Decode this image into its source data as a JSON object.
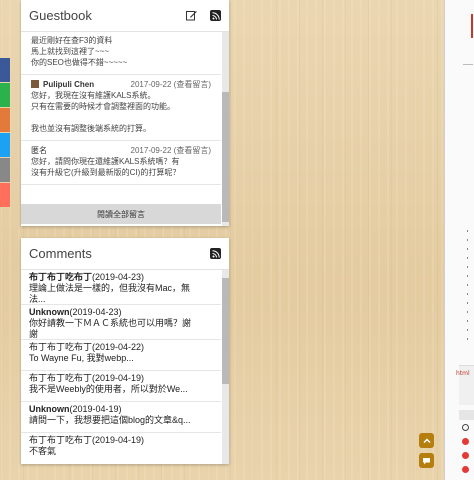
{
  "share_bar": {
    "colors": [
      "#3b5998",
      "#2bb24c",
      "#1da1f2",
      "#dd4b39",
      "#1e88e5",
      "#888888",
      "#ff6f5b"
    ]
  },
  "guestbook": {
    "title": "Guestbook",
    "edit_icon": "pencil-icon",
    "rss_icon": "rss-icon",
    "entries": [
      {
        "lines": [
          "最近剛好在查F3的資料",
          "馬上就找到這裡了~~~",
          "你的SEO也做得不錯~~~~~"
        ]
      },
      {
        "name": "Pulipuli Chen",
        "date": "2017-09-22 (查看留言)",
        "lines": [
          "您好，我現在沒有維護KALS系統。",
          "只有在需要的時候才會調整裡面的功能。",
          "",
          "我也並沒有調整後端系統的打算。"
        ]
      },
      {
        "name": "匿名",
        "date": "2017-09-22 (查看留言)",
        "lines": [
          "您好，請問你現在還維護KALS系統嗎？有",
          "沒有升級它(升級到最新版的CI)的打算呢？"
        ]
      }
    ],
    "read_all": "閱讀全部留言"
  },
  "comments": {
    "title": "Comments",
    "rss_icon": "rss-icon",
    "items": [
      {
        "author": "布丁布丁吃布丁",
        "date": "(2019-04-23)",
        "line1": "理論上做法是一樣的，但我沒有Mac，無",
        "line2": "法..."
      },
      {
        "author": "Unknown",
        "date": "(2019-04-23)",
        "line1": "你好請教一下ＭＡＣ系統也可以用嗎？謝",
        "line2": "謝"
      },
      {
        "author": "布丁布丁吃布丁",
        "date": "(2019-04-22)",
        "line1": "To Wayne Fu, 我對webp...",
        "line2": ""
      },
      {
        "author": "布丁布丁吃布丁",
        "date": "(2019-04-19)",
        "line1": "我不是Weebly的使用者，所以對於We...",
        "line2": ""
      },
      {
        "author": "Unknown",
        "date": "(2019-04-19)",
        "line1": "請問一下，我想要把這個blog的文章&q...",
        "line2": ""
      },
      {
        "author": "布丁布丁吃布丁",
        "date": "(2019-04-19)",
        "line1": "不客氣",
        "line2": ""
      }
    ]
  },
  "floating": {
    "top_icon": "chevron-up-icon",
    "chat_icon": "chat-icon"
  },
  "devtools": {
    "html_label": "html"
  }
}
